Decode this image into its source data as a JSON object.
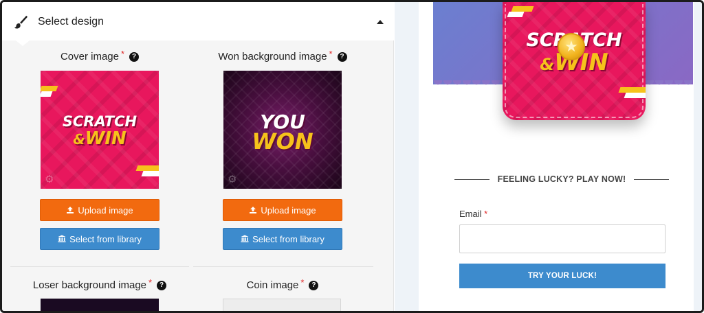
{
  "panel": {
    "title": "Select design",
    "icons": {
      "header": "paintbrush-icon",
      "collapse": "caret-up-icon"
    }
  },
  "fields": {
    "cover": {
      "label": "Cover image",
      "required_mark": "*",
      "help": "?",
      "art_line1": "SCRATCH",
      "art_line2_a": "&",
      "art_line2_b": "WIN"
    },
    "won": {
      "label": "Won background image",
      "required_mark": "*",
      "help": "?",
      "art_line1": "YOU",
      "art_line2": "WON"
    },
    "loser": {
      "label": "Loser background image",
      "required_mark": "*",
      "help": "?"
    },
    "coin": {
      "label": "Coin image",
      "required_mark": "*",
      "help": "?"
    }
  },
  "buttons": {
    "upload": "Upload image",
    "library": "Select from library"
  },
  "preview": {
    "ticket_line1": "SCRATCH",
    "ticket_line2_a": "&",
    "ticket_line2_b": "WIN",
    "heading": "FEELING LUCKY? PLAY NOW!",
    "email_label": "Email",
    "email_required": "*",
    "email_value": "",
    "cta": "TRY YOUR LUCK!"
  },
  "colors": {
    "upload_button": "#f26a0f",
    "library_button": "#3d8bcd",
    "cta_button": "#3d8bcd",
    "card_pink": "#e8175d",
    "art_yellow": "#f6c21b"
  }
}
